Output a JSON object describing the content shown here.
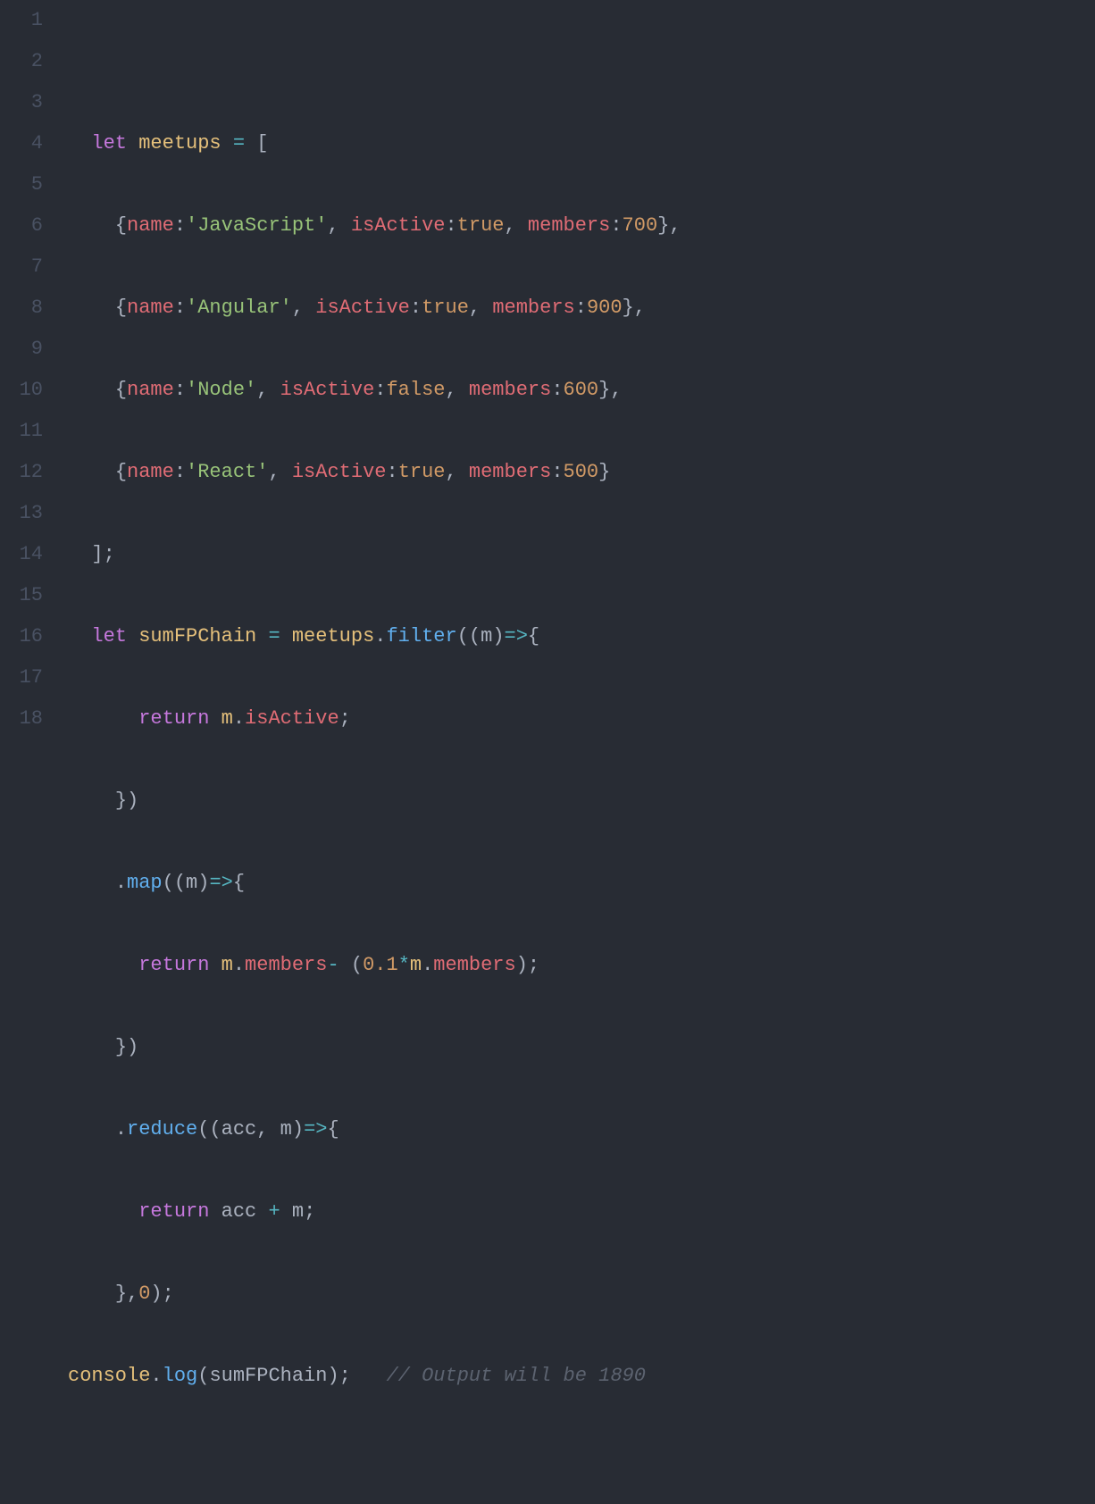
{
  "lineNumbers": [
    "1",
    "2",
    "3",
    "4",
    "5",
    "6",
    "7",
    "8",
    "9",
    "10",
    "11",
    "12",
    "13",
    "14",
    "15",
    "16",
    "17",
    "18"
  ],
  "kw": {
    "let": "let",
    "return": "return"
  },
  "id": {
    "meetups": "meetups",
    "sumFPChain": "sumFPChain",
    "console": "console",
    "m": "m",
    "acc": "acc"
  },
  "prop": {
    "name": "name",
    "isActive": "isActive",
    "members": "members"
  },
  "method": {
    "filter": "filter",
    "map": "map",
    "reduce": "reduce",
    "log": "log"
  },
  "str": {
    "JavaScript": "'JavaScript'",
    "Angular": "'Angular'",
    "Node": "'Node'",
    "React": "'React'"
  },
  "bool": {
    "true": "true",
    "false": "false"
  },
  "num": {
    "n700": "700",
    "n900": "900",
    "n600": "600",
    "n500": "500",
    "n0": "0",
    "n0_1": "0.1"
  },
  "comment": {
    "output": "// Output will be 1890"
  }
}
